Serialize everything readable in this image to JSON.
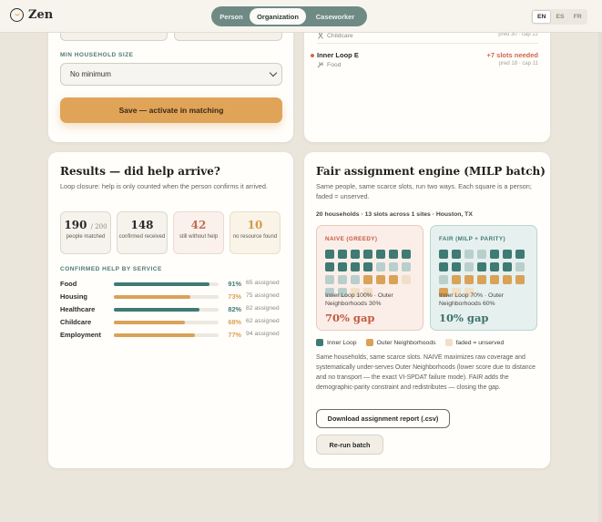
{
  "app": {
    "brand": "Zen"
  },
  "header": {
    "roles": [
      "Person",
      "Organization",
      "Caseworker"
    ],
    "active_role": "Organization",
    "languages": [
      "EN",
      "ES",
      "FR"
    ],
    "active_language": "EN"
  },
  "settings_card": {
    "household_label": "MIN HOUSEHOLD SIZE",
    "household_value": "No minimum",
    "save_label": "Save — activate in matching"
  },
  "sites_card": {
    "sites": [
      {
        "name": "",
        "category": "Childcare",
        "slots": "",
        "pred": "pred 30 · cap 22"
      },
      {
        "name": "Inner Loop E",
        "category": "Food",
        "slots": "+7 slots needed",
        "pred": "pred 18 · cap 11"
      }
    ]
  },
  "results": {
    "title": "Results — did help arrive?",
    "subtitle": "Loop closure: help is only counted when the person confirms it arrived.",
    "stats": [
      {
        "value": "190",
        "suffix": "/ 200",
        "label": "people matched"
      },
      {
        "value": "148",
        "suffix": "",
        "label": "confirmed received"
      },
      {
        "value": "42",
        "suffix": "",
        "label": "still without help"
      },
      {
        "value": "10",
        "suffix": "",
        "label": "no resource found"
      }
    ],
    "section_label": "CONFIRMED HELP BY SERVICE",
    "services": [
      {
        "name": "Food",
        "pct": 91,
        "pct_label": "91%",
        "assigned": "65 assigned",
        "color": "#3f7a74"
      },
      {
        "name": "Housing",
        "pct": 73,
        "pct_label": "73%",
        "assigned": "75 assigned",
        "color": "#d9a257"
      },
      {
        "name": "Healthcare",
        "pct": 82,
        "pct_label": "82%",
        "assigned": "82 assigned",
        "color": "#3f7a74"
      },
      {
        "name": "Childcare",
        "pct": 68,
        "pct_label": "68%",
        "assigned": "62 assigned",
        "color": "#d9a257"
      },
      {
        "name": "Employment",
        "pct": 77,
        "pct_label": "77%",
        "assigned": "94 assigned",
        "color": "#d9a257"
      }
    ]
  },
  "fair": {
    "title": "Fair assignment engine (MILP batch)",
    "subtitle": "Same people, same scarce slots, run two ways. Each square is a person; faded = unserved.",
    "meta": "20 households · 13 slots across 1 sites · Houston, TX",
    "naive": {
      "label": "NAIVE (GREEDY)",
      "grid": [
        "I",
        "I",
        "I",
        "I",
        "I",
        "I",
        "I",
        "I",
        "I",
        "I",
        "I",
        "i",
        "i",
        "i",
        "i",
        "i",
        "i",
        "O",
        "O",
        "O",
        "o",
        "i",
        "i",
        "o",
        "o"
      ],
      "caption": "Inner Loop 100% · Outer Neighborhoods 30%",
      "gap": "70% gap"
    },
    "fair_panel": {
      "label": "FAIR (MILP + PARITY)",
      "grid": [
        "I",
        "I",
        "i",
        "i",
        "I",
        "I",
        "I",
        "I",
        "I",
        "i",
        "I",
        "I",
        "I",
        "i",
        "i",
        "O",
        "O",
        "O",
        "O",
        "O",
        "O",
        "O",
        "o",
        "o"
      ],
      "caption": "Inner Loop 70% · Outer Neighborhoods 60%",
      "gap": "10% gap"
    },
    "legend": [
      {
        "label": "Inner Loop",
        "color": "#3f7a74"
      },
      {
        "label": "Outer Neighborhoods",
        "color": "#d9a257"
      },
      {
        "label": "faded = unserved",
        "color": "#f1dfc7"
      }
    ],
    "explanation": "Same households, same scarce slots. NAIVE maximizes raw coverage and systematically under-serves Outer Neighborhoods (lower score due to distance and no transport — the exact VI-SPDAT failure mode). FAIR adds the demographic-parity constraint and redistributes — closing the gap.",
    "download_label": "Download assignment report (.csv)",
    "rerun_label": "Re-run batch"
  },
  "colors": {
    "inner": "#3f7a74",
    "inner_faded": "#b9cfcc",
    "outer": "#d9a257",
    "outer_faded": "#f1dfc7"
  }
}
